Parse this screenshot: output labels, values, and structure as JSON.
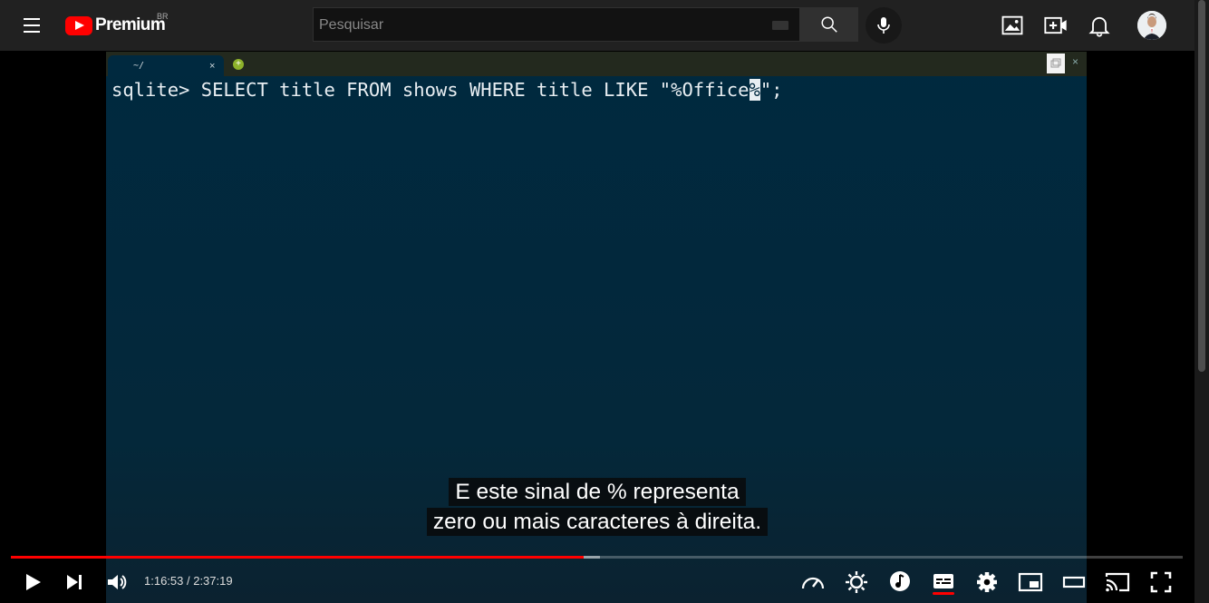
{
  "header": {
    "logo_text": "Premium",
    "country_code": "BR",
    "search_placeholder": "Pesquisar"
  },
  "terminal": {
    "tab_label": "~/",
    "tab_close": "×",
    "add_tab": "+",
    "close_window": "×",
    "command_before_cursor": "sqlite> SELECT title FROM shows WHERE title LIKE \"%Office",
    "cursor_char": "%",
    "command_after_cursor": "\";"
  },
  "captions": {
    "line1": "E este sinal de % representa",
    "line2": "zero ou mais caracteres à direita."
  },
  "player": {
    "time_current": "1:16:53",
    "time_total": "2:37:19",
    "time_separator": " / ",
    "progress_fraction": 0.489,
    "buffered_fraction": 0.503
  },
  "colors": {
    "youtube_red": "#ff0000",
    "terminal_bg": "#00293f"
  },
  "icons": [
    "menu-icon",
    "youtube-logo-icon",
    "keyboard-icon",
    "search-icon",
    "mic-icon",
    "image-icon",
    "create-icon",
    "bell-icon",
    "play-icon",
    "next-icon",
    "volume-icon",
    "speed-icon",
    "ambient-icon",
    "music-icon",
    "subtitles-icon",
    "settings-icon",
    "miniplayer-icon",
    "theater-icon",
    "cast-icon",
    "fullscreen-icon"
  ]
}
